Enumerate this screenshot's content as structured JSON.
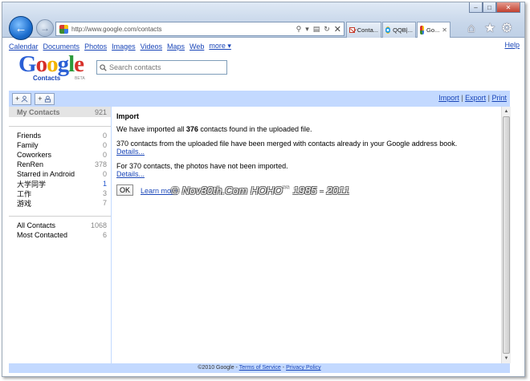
{
  "browser": {
    "url": "http://www.google.com/contacts",
    "tabs": [
      {
        "label": "Conta...",
        "icon": "gmail-icon"
      },
      {
        "label": "QQB|...",
        "icon": "qq-icon"
      },
      {
        "label": "Go...",
        "icon": "google-icon"
      }
    ],
    "window_controls": {
      "minimize": "–",
      "maximize": "□",
      "close": "✕"
    }
  },
  "gbar": {
    "links": [
      "Calendar",
      "Documents",
      "Photos",
      "Images",
      "Videos",
      "Maps",
      "Web",
      "more ▾"
    ],
    "help": "Help"
  },
  "logo": {
    "word": [
      "G",
      "o",
      "o",
      "g",
      "l",
      "e"
    ],
    "sub": "Contacts",
    "beta": "BETA"
  },
  "search": {
    "placeholder": "Search contacts"
  },
  "toolbar": {
    "add_contact": "+",
    "add_group": "+",
    "import": "Import",
    "export": "Export",
    "print": "Print",
    "sep": "|"
  },
  "sidebar": {
    "my_contacts": {
      "label": "My Contacts",
      "count": "921"
    },
    "groups": [
      {
        "label": "Friends",
        "count": "0",
        "blue": false
      },
      {
        "label": "Family",
        "count": "0",
        "blue": false
      },
      {
        "label": "Coworkers",
        "count": "0",
        "blue": false
      },
      {
        "label": "RenRen",
        "count": "378",
        "blue": false
      },
      {
        "label": "Starred in Android",
        "count": "0",
        "blue": false
      },
      {
        "label": "大学同学",
        "count": "1",
        "blue": true
      },
      {
        "label": "工作",
        "count": "3",
        "blue": false
      },
      {
        "label": "游戏",
        "count": "7",
        "blue": false
      }
    ],
    "system": [
      {
        "label": "All Contacts",
        "count": "1068"
      },
      {
        "label": "Most Contacted",
        "count": "6"
      }
    ]
  },
  "main": {
    "title": "Import",
    "msg1_pre": "We have imported all ",
    "msg1_num": "376",
    "msg1_post": " contacts found in the uploaded file.",
    "msg2": "370 contacts from the uploaded file have been merged with contacts already in your Google address book.",
    "details1": "Details...",
    "msg3": "For 370 contacts, the photos have not been imported.",
    "details2": "Details...",
    "ok": "OK",
    "learn_more": "Learn more"
  },
  "watermark": "© Nov30th.Com HOHO`` 1985 - 2011",
  "footer": {
    "copyright": "©2010 Google - ",
    "terms": "Terms of Service",
    "dash": " - ",
    "privacy": "Privacy Policy"
  }
}
